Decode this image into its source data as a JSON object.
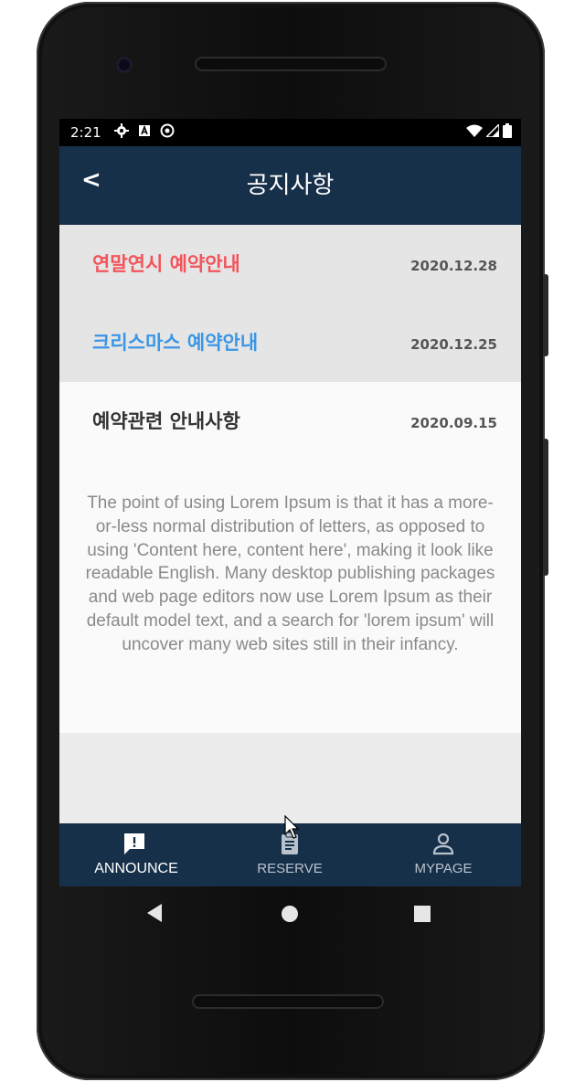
{
  "status": {
    "time": "2:21",
    "left_icons": [
      "gear-icon",
      "a-icon",
      "sync-icon"
    ],
    "right_icons": [
      "wifi-icon",
      "signal-icon",
      "battery-icon"
    ]
  },
  "header": {
    "back_label": "<",
    "title": "공지사항",
    "background": "#17304a"
  },
  "notices": [
    {
      "title": "연말연시 예약안내",
      "date": "2020.12.28",
      "color": "#f2545b",
      "expanded": false
    },
    {
      "title": "크리스마스 예약안내",
      "date": "2020.12.25",
      "color": "#3b96e6",
      "expanded": false
    },
    {
      "title": "예약관련 안내사항",
      "date": "2020.09.15",
      "color": "#333333",
      "expanded": true,
      "body": "The point of using Lorem Ipsum is that it has a more-or-less normal distribution of letters, as opposed to using 'Content here, content here', making it look like readable English. Many desktop publishing packages and web page editors now use Lorem Ipsum as their default model text, and a search for 'lorem ipsum' will uncover many web sites still in their infancy."
    }
  ],
  "bottom_nav": {
    "items": [
      {
        "label": "ANNOUNCE",
        "icon": "announce-icon",
        "active": true
      },
      {
        "label": "RESERVE",
        "icon": "clipboard-icon",
        "active": false
      },
      {
        "label": "MYPAGE",
        "icon": "person-icon",
        "active": false
      }
    ],
    "active_color": "#ffffff",
    "inactive_color": "#b9c2cc"
  },
  "system_nav": [
    "back-icon",
    "home-icon",
    "recents-icon"
  ]
}
